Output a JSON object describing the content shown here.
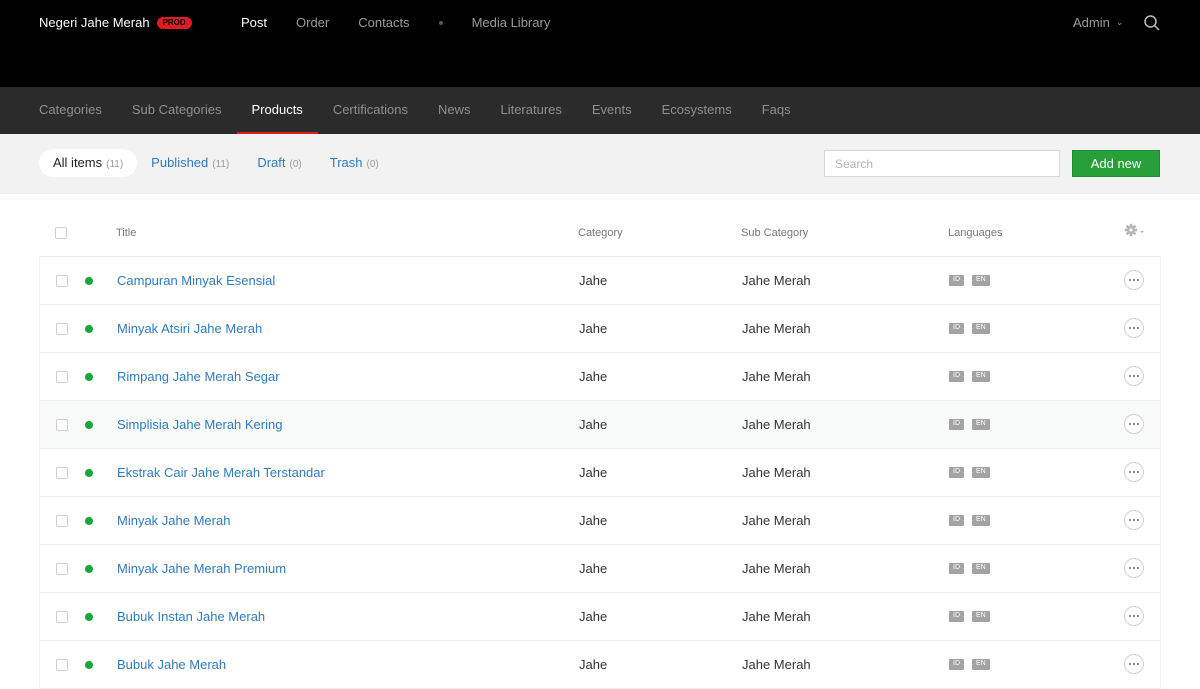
{
  "app": {
    "brand": "Negeri Jahe Merah",
    "env_badge": "PROD"
  },
  "topnav": {
    "items": [
      {
        "label": "Post",
        "active": true
      },
      {
        "label": "Order",
        "active": false
      },
      {
        "label": "Contacts",
        "active": false
      },
      {
        "label": "Media Library",
        "active": false
      }
    ],
    "user": "Admin"
  },
  "subnav": {
    "items": [
      {
        "label": "Categories",
        "active": false
      },
      {
        "label": "Sub Categories",
        "active": false
      },
      {
        "label": "Products",
        "active": true
      },
      {
        "label": "Certifications",
        "active": false
      },
      {
        "label": "News",
        "active": false
      },
      {
        "label": "Literatures",
        "active": false
      },
      {
        "label": "Events",
        "active": false
      },
      {
        "label": "Ecosystems",
        "active": false
      },
      {
        "label": "Faqs",
        "active": false
      }
    ]
  },
  "filters": {
    "items": [
      {
        "label": "All items",
        "count": "(11)",
        "active": true
      },
      {
        "label": "Published",
        "count": "(11)",
        "active": false
      },
      {
        "label": "Draft",
        "count": "(0)",
        "active": false
      },
      {
        "label": "Trash",
        "count": "(0)",
        "active": false
      }
    ],
    "search_placeholder": "Search",
    "add_label": "Add new"
  },
  "table": {
    "columns": {
      "title": "Title",
      "category": "Category",
      "sub_category": "Sub Category",
      "languages": "Languages"
    },
    "rows": [
      {
        "title": "Campuran Minyak Esensial",
        "category": "Jahe",
        "sub_category": "Jahe Merah",
        "langs": [
          "ID",
          "EN"
        ]
      },
      {
        "title": "Minyak Atsiri Jahe Merah",
        "category": "Jahe",
        "sub_category": "Jahe Merah",
        "langs": [
          "ID",
          "EN"
        ]
      },
      {
        "title": "Rimpang Jahe Merah Segar",
        "category": "Jahe",
        "sub_category": "Jahe Merah",
        "langs": [
          "ID",
          "EN"
        ]
      },
      {
        "title": "Simplisia Jahe Merah Kering",
        "category": "Jahe",
        "sub_category": "Jahe Merah",
        "langs": [
          "ID",
          "EN"
        ]
      },
      {
        "title": "Ekstrak Cair Jahe Merah Terstandar",
        "category": "Jahe",
        "sub_category": "Jahe Merah",
        "langs": [
          "ID",
          "EN"
        ]
      },
      {
        "title": "Minyak Jahe Merah",
        "category": "Jahe",
        "sub_category": "Jahe Merah",
        "langs": [
          "ID",
          "EN"
        ]
      },
      {
        "title": "Minyak Jahe Merah Premium",
        "category": "Jahe",
        "sub_category": "Jahe Merah",
        "langs": [
          "ID",
          "EN"
        ]
      },
      {
        "title": "Bubuk Instan Jahe Merah",
        "category": "Jahe",
        "sub_category": "Jahe Merah",
        "langs": [
          "ID",
          "EN"
        ]
      },
      {
        "title": "Bubuk Jahe Merah",
        "category": "Jahe",
        "sub_category": "Jahe Merah",
        "langs": [
          "ID",
          "EN"
        ]
      }
    ]
  },
  "colors": {
    "accent_red": "#e11b22",
    "link_blue": "#2f7bbf",
    "add_green": "#27a03a",
    "status_green": "#1aa33a"
  }
}
